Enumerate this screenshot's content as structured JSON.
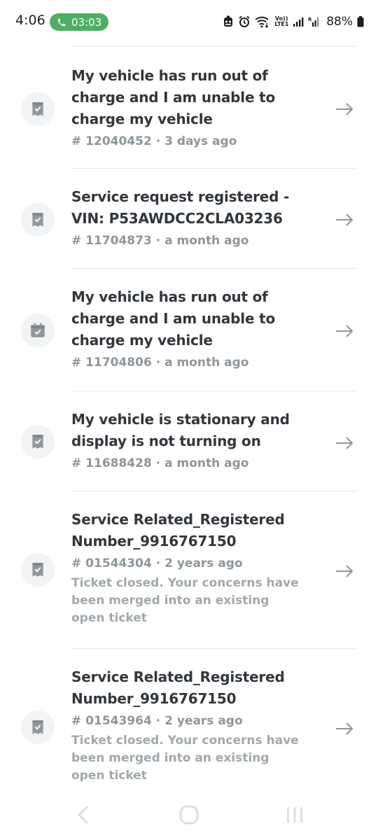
{
  "status_bar": {
    "time": "4:06",
    "call_timer": "03:03",
    "volte_label": "Vo)) LTE1",
    "battery": "88%",
    "accent_call": "#4caf63"
  },
  "tickets": [
    {
      "title": "My vehicle has run out of charge and I am unable to charge my vehicle",
      "meta": "# 12040452 · 3 days ago",
      "note": "",
      "icon": "receipt-check-icon"
    },
    {
      "title": "Service request registered - VIN: P53AWDCC2CLA03236",
      "meta": "# 11704873 · a month ago",
      "note": "",
      "icon": "receipt-check-icon"
    },
    {
      "title": "My vehicle has run out of charge and I am unable to charge my vehicle",
      "meta": "# 11704806 · a month ago",
      "note": "",
      "icon": "calendar-check-icon"
    },
    {
      "title": "My vehicle is stationary and display is not turning on",
      "meta": "# 11688428 · a month ago",
      "note": "",
      "icon": "receipt-check-icon"
    },
    {
      "title": "Service Related_Registered Number_9916767150",
      "meta": "# 01544304 · 2 years ago",
      "note": "Ticket closed. Your concerns have been merged into an existing open ticket",
      "icon": "receipt-check-icon"
    },
    {
      "title": "Service Related_Registered Number_9916767150",
      "meta": "# 01543964 · 2 years ago",
      "note": "Ticket closed. Your concerns have been merged into an existing open ticket",
      "icon": "receipt-check-icon"
    }
  ],
  "nav_bar": {
    "buttons": [
      "back-icon",
      "home-icon",
      "recents-icon"
    ]
  }
}
